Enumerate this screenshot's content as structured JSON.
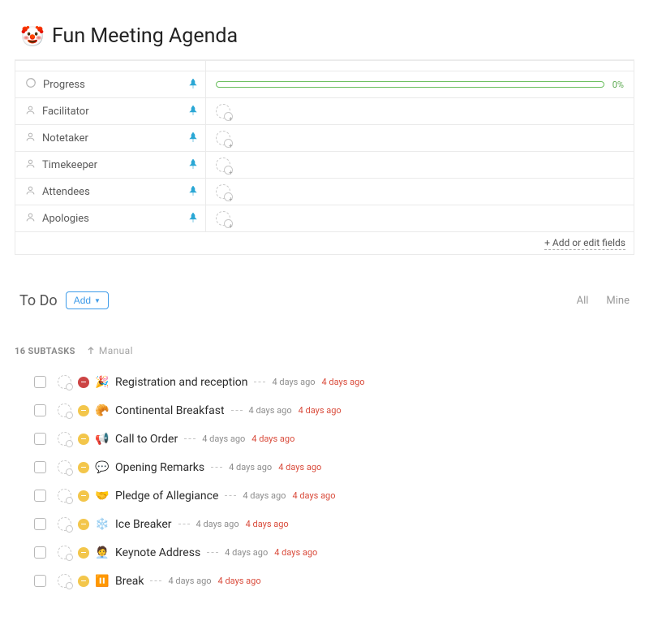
{
  "title": {
    "emoji": "🤡",
    "text": "Fun Meeting Agenda"
  },
  "fields": [
    {
      "icon": "progress",
      "label": "Progress",
      "pinned": true,
      "value_type": "progress",
      "progress_pct": "0%"
    },
    {
      "icon": "person",
      "label": "Facilitator",
      "pinned": true,
      "value_type": "person"
    },
    {
      "icon": "person",
      "label": "Notetaker",
      "pinned": true,
      "value_type": "person"
    },
    {
      "icon": "person",
      "label": "Timekeeper",
      "pinned": true,
      "value_type": "person"
    },
    {
      "icon": "person",
      "label": "Attendees",
      "pinned": true,
      "value_type": "person"
    },
    {
      "icon": "person",
      "label": "Apologies",
      "pinned": true,
      "value_type": "person"
    }
  ],
  "add_fields_label": "+ Add or edit fields",
  "todo": {
    "title": "To Do",
    "add_label": "Add",
    "filter_all": "All",
    "filter_mine": "Mine"
  },
  "subtasks_header": {
    "count": "16 SUBTASKS",
    "sort_label": "Manual"
  },
  "subtasks": [
    {
      "status_color": "red",
      "emoji": "🎉",
      "title": "Registration and reception",
      "created": "4 days ago",
      "due": "4 days ago"
    },
    {
      "status_color": "yellow",
      "emoji": "🥐",
      "title": "Continental Breakfast",
      "created": "4 days ago",
      "due": "4 days ago"
    },
    {
      "status_color": "yellow",
      "emoji": "📢",
      "title": "Call to Order",
      "created": "4 days ago",
      "due": "4 days ago"
    },
    {
      "status_color": "yellow",
      "emoji": "💬",
      "title": "Opening Remarks",
      "created": "4 days ago",
      "due": "4 days ago"
    },
    {
      "status_color": "yellow",
      "emoji": "🤝",
      "title": "Pledge of Allegiance",
      "created": "4 days ago",
      "due": "4 days ago"
    },
    {
      "status_color": "yellow",
      "emoji": "❄️",
      "title": "Ice Breaker",
      "created": "4 days ago",
      "due": "4 days ago"
    },
    {
      "status_color": "yellow",
      "emoji": "🧑‍💼",
      "title": "Keynote Address",
      "created": "4 days ago",
      "due": "4 days ago"
    },
    {
      "status_color": "yellow",
      "emoji": "⏸️",
      "title": "Break",
      "created": "4 days ago",
      "due": "4 days ago"
    }
  ]
}
